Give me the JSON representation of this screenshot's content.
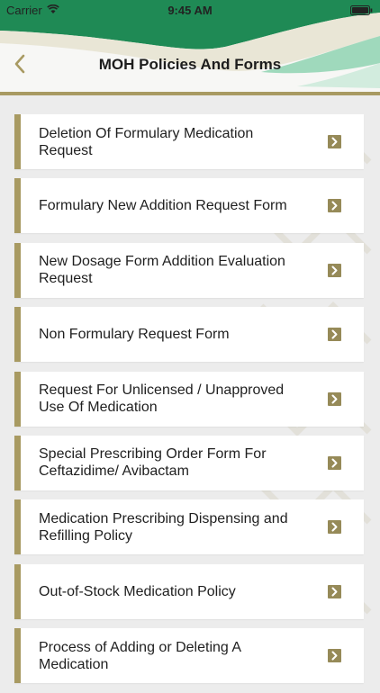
{
  "status_bar": {
    "carrier": "Carrier",
    "time": "9:45 AM"
  },
  "header": {
    "title": "MOH Policies And Forms",
    "back_icon": "chevron-left-icon"
  },
  "colors": {
    "accent_gold": "#a89a62",
    "header_green": "#1f8a55",
    "background": "#ececec"
  },
  "items": [
    {
      "label": "Deletion Of Formulary Medication Request",
      "icon": "chevron-right-icon"
    },
    {
      "label": "Formulary New Addition Request Form",
      "icon": "chevron-right-icon"
    },
    {
      "label": "New Dosage Form Addition Evaluation Request",
      "icon": "chevron-right-icon"
    },
    {
      "label": "Non Formulary Request Form",
      "icon": "chevron-right-icon"
    },
    {
      "label": "Request For Unlicensed / Unapproved Use Of Medication",
      "icon": "chevron-right-icon"
    },
    {
      "label": "Special Prescribing Order Form For Ceftazidime/ Avibactam",
      "icon": "chevron-right-icon"
    },
    {
      "label": "Medication Prescribing Dispensing and Refilling Policy",
      "icon": "chevron-right-icon"
    },
    {
      "label": "Out-of-Stock Medication Policy",
      "icon": "chevron-right-icon"
    },
    {
      "label": "Process of Adding or Deleting A Medication",
      "icon": "chevron-right-icon"
    }
  ]
}
